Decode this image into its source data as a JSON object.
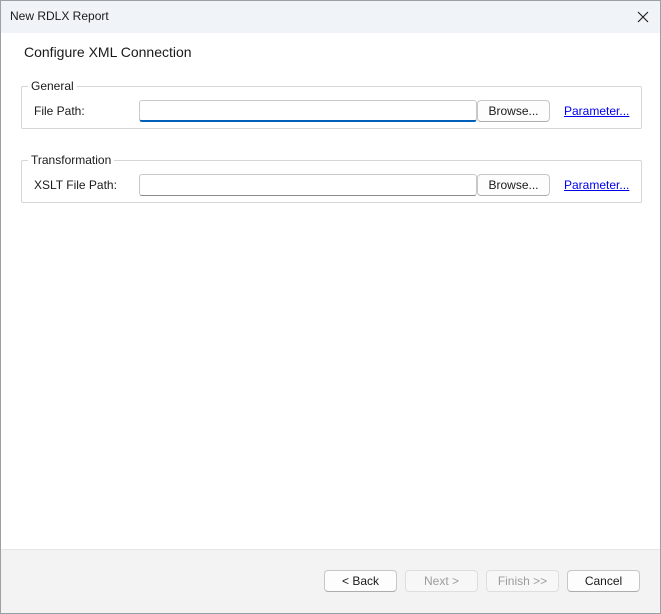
{
  "window": {
    "title": "New RDLX Report",
    "close_glyph": "✕"
  },
  "page": {
    "heading": "Configure XML Connection"
  },
  "general": {
    "legend": "General",
    "file_path_label": "File Path:",
    "file_path_value": "",
    "browse_label": "Browse...",
    "parameter_label": "Parameter..."
  },
  "transformation": {
    "legend": "Transformation",
    "xslt_label": "XSLT File Path:",
    "xslt_value": "",
    "browse_label": "Browse...",
    "parameter_label": "Parameter..."
  },
  "footer": {
    "back_label": "< Back",
    "next_label": "Next >",
    "finish_label": "Finish >>",
    "cancel_label": "Cancel",
    "next_enabled": false,
    "finish_enabled": false
  },
  "colors": {
    "accent": "#005fb8",
    "link": "#0000ee",
    "titlebar": "#f0f4f9",
    "footer": "#f3f3f3"
  }
}
